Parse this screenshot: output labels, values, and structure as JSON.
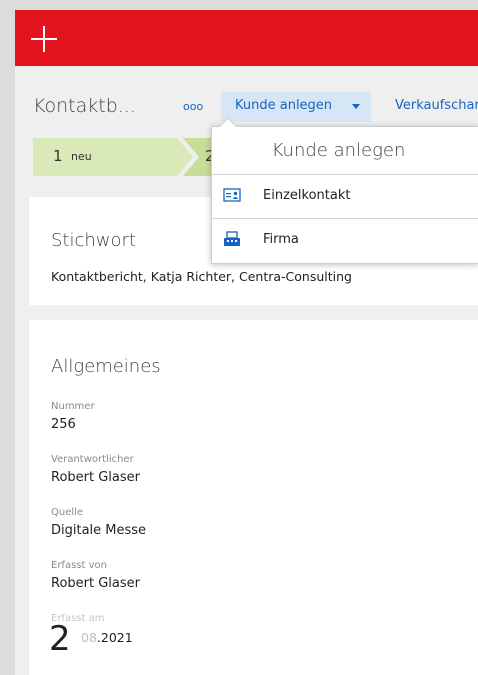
{
  "header": {
    "plus_icon": "plus-icon",
    "background": "#e3141d"
  },
  "cmdbar": {
    "title": "Kontaktb...",
    "more_icon": "more-icon",
    "more_label": "ooo",
    "active_command": "Kunde anlegen",
    "next_command": "Verkaufschan"
  },
  "stages": [
    {
      "number": "1",
      "label": "neu"
    },
    {
      "number": "2",
      "label": ""
    }
  ],
  "keyword_card": {
    "heading": "Stichwort",
    "value": "Kontaktbericht, Katja Richter, Centra-Consulting"
  },
  "general_card": {
    "heading": "Allgemeines",
    "fields": [
      {
        "label": "Nummer",
        "value": "256"
      },
      {
        "label": "Verantwortlicher",
        "value": "Robert Glaser"
      },
      {
        "label": "Quelle",
        "value": "Digitale Messe"
      },
      {
        "label": "Erfasst von",
        "value": "Robert Glaser"
      }
    ],
    "date_field": {
      "label": "Erfasst am",
      "day": "2",
      "faded": "08",
      "rest": ".2021"
    }
  },
  "dropdown": {
    "title": "Kunde anlegen",
    "items": [
      {
        "label": "Einzelkontakt",
        "icon": "contact-card-icon"
      },
      {
        "label": "Firma",
        "icon": "building-icon"
      }
    ]
  },
  "colors": {
    "accent": "#1565c0",
    "active_bg": "#d6e6f5",
    "stage_1": "#d9e9b8",
    "stage_2": "#c8dd97"
  }
}
